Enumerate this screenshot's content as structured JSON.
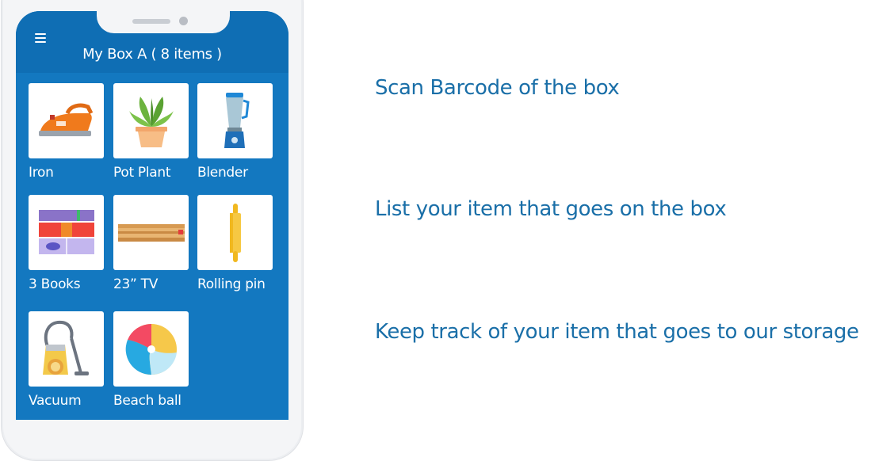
{
  "app": {
    "box_title": "My Box A ( 8 items )"
  },
  "items": [
    {
      "label": "Iron",
      "icon": "iron-icon"
    },
    {
      "label": "Pot Plant",
      "icon": "pot-plant-icon"
    },
    {
      "label": "Blender",
      "icon": "blender-icon"
    },
    {
      "label": "3 Books",
      "icon": "books-icon"
    },
    {
      "label": "23” TV",
      "icon": "tv-icon"
    },
    {
      "label": "Rolling pin",
      "icon": "rolling-pin-icon"
    },
    {
      "label": "Vacuum",
      "icon": "vacuum-icon"
    },
    {
      "label": "Beach ball",
      "icon": "beach-ball-icon"
    }
  ],
  "features": [
    "Scan Barcode of the box",
    "List your item that goes on the box",
    "Keep track of your item that goes to our storage"
  ],
  "colors": {
    "screen_blue": "#1378c0",
    "header_blue": "#0f6eb4",
    "feature_text": "#1a6fa8"
  }
}
